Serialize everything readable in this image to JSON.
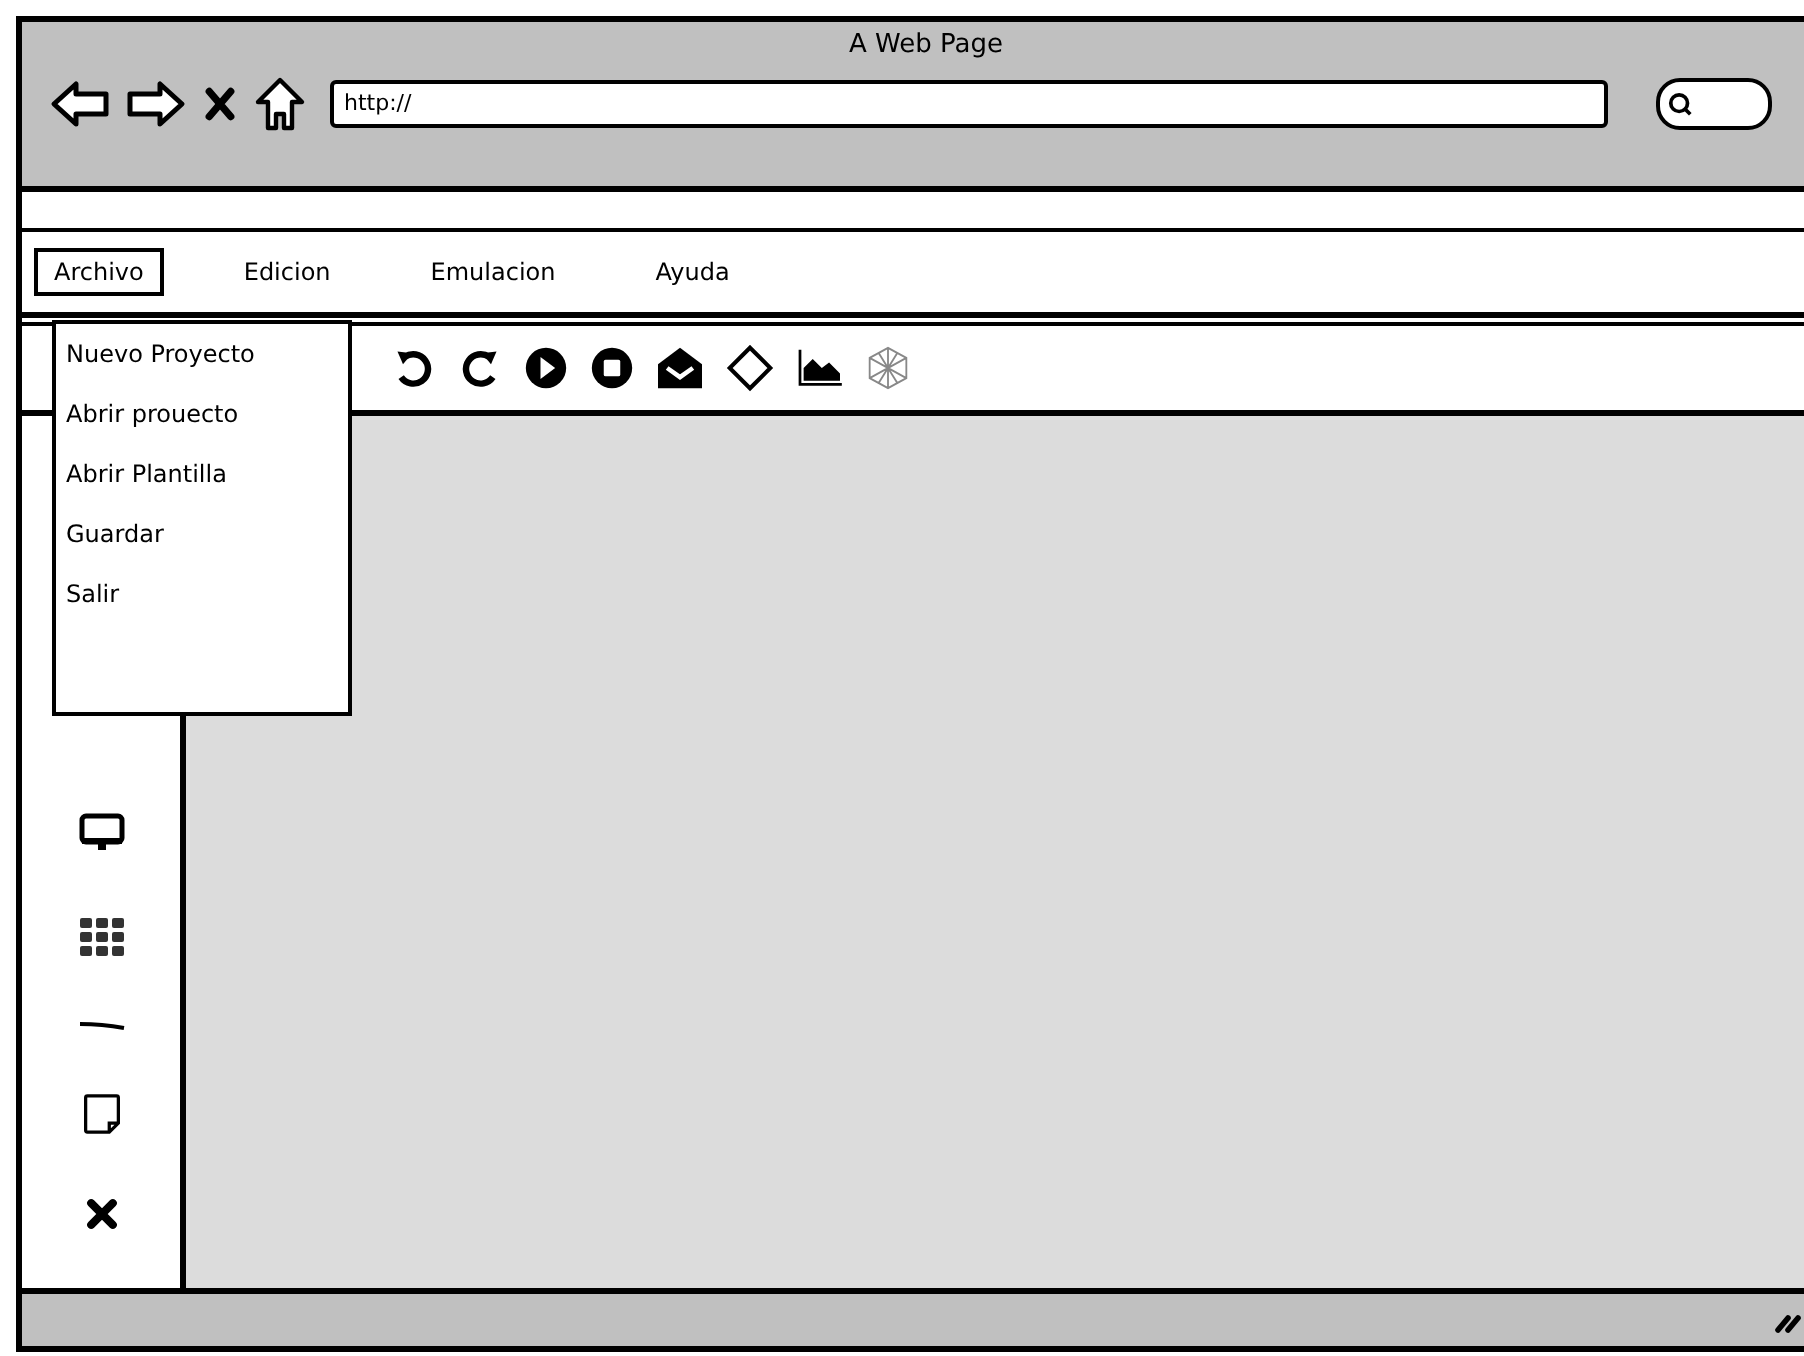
{
  "window": {
    "title": "A Web Page"
  },
  "address_bar": {
    "value": "http://"
  },
  "menu_bar": [
    {
      "label": "Archivo",
      "selected": true
    },
    {
      "label": "Edicion",
      "selected": false
    },
    {
      "label": "Emulacion",
      "selected": false
    },
    {
      "label": "Ayuda",
      "selected": false
    }
  ],
  "dropdown_menu": {
    "items": [
      "Nuevo Proyecto",
      "Abrir prouecto",
      "Abrir Plantilla",
      "Guardar",
      "Salir"
    ]
  }
}
